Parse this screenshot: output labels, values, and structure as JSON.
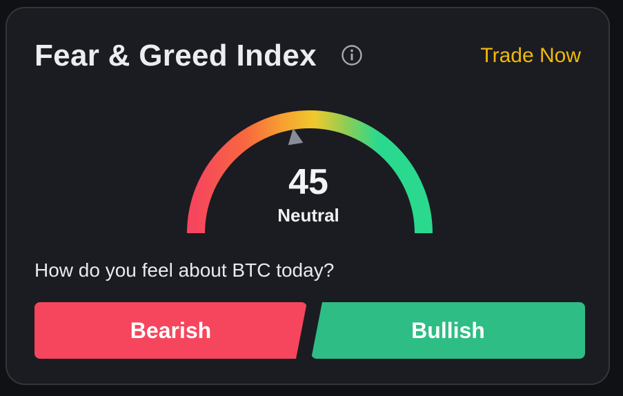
{
  "widget": {
    "title": "Fear & Greed Index",
    "info_icon": "info-circle-icon",
    "trade_link": "Trade Now"
  },
  "gauge": {
    "value": "45",
    "label": "Neutral",
    "scale_min": 0,
    "scale_max": 100,
    "pointer_icon": "triangle-pointer-icon",
    "colors": {
      "fear": "#f6465d",
      "neutral": "#f0c92d",
      "greed": "#2ad98e"
    }
  },
  "sentiment": {
    "question": "How do you feel about BTC today?",
    "bearish_label": "Bearish",
    "bullish_label": "Bullish",
    "bearish_color": "#f6465d",
    "bullish_color": "#2ebd85"
  },
  "colors": {
    "background": "#1b1c21",
    "accent": "#f0b90b"
  }
}
